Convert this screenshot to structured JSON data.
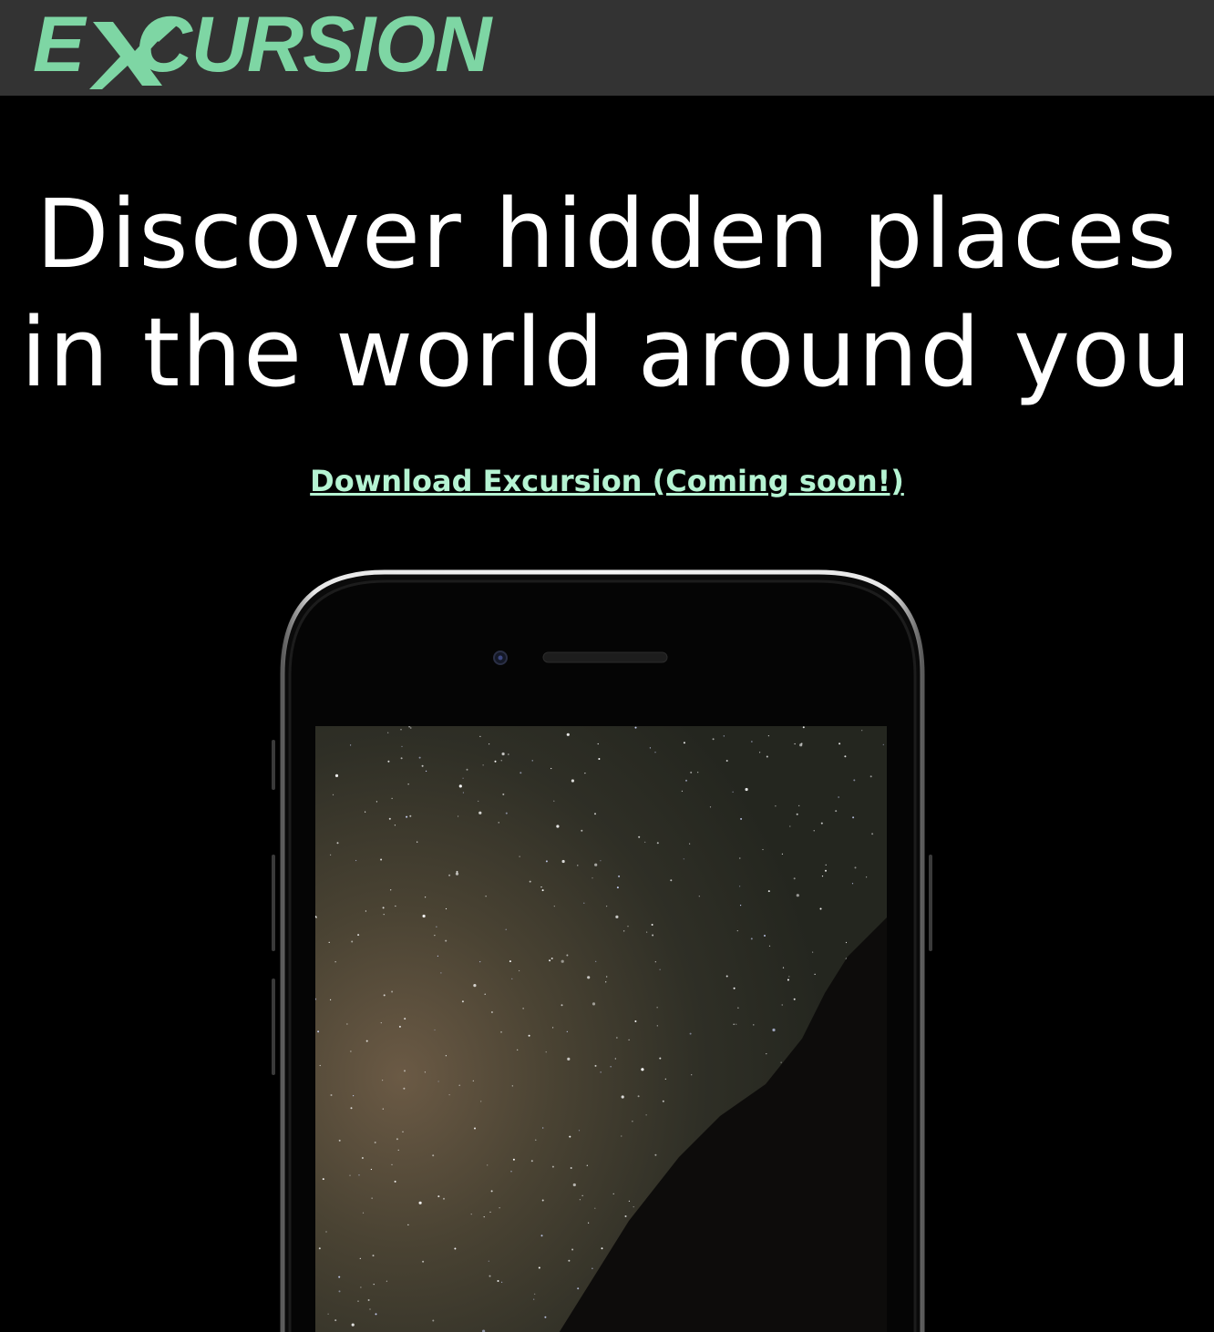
{
  "brand": {
    "logo_text": "EXCURSION",
    "logo_icon": "airplane-icon",
    "logo_color": "#7ed6a4",
    "header_bg": "#333333"
  },
  "hero": {
    "headline_line1": "Discover hidden places",
    "headline_line2": "in the world around you",
    "download_link": "Download Excursion (Coming soon!)",
    "link_color": "#b5f3d2"
  },
  "device": {
    "type": "smartphone-mockup",
    "screen_content": "starry-night-sky-image"
  }
}
